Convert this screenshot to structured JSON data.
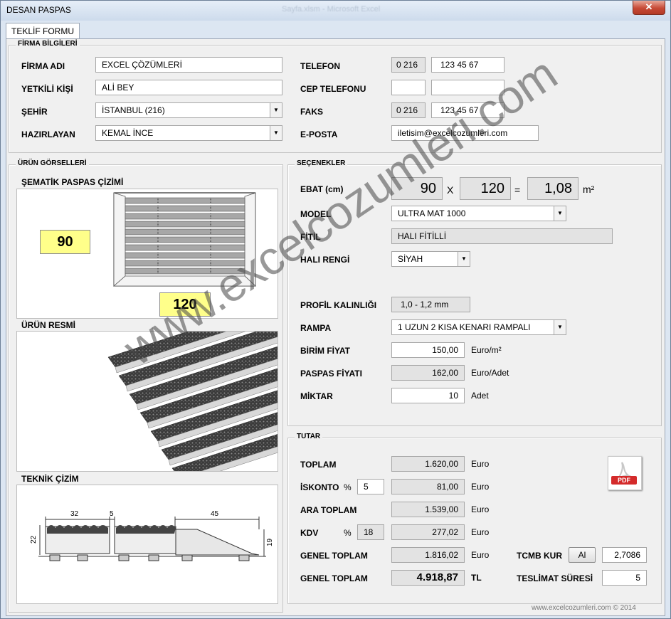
{
  "window": {
    "title": "DESAN PASPAS",
    "ghost_title": "Sayfa.xlsm - Microsoft Excel",
    "close_label": "✕"
  },
  "tab": {
    "label": "TEKLİF FORMU"
  },
  "firma": {
    "frame_label": "FİRMA BİLGİLERİ",
    "firma_adi_label": "FİRMA ADI",
    "firma_adi_value": "EXCEL ÇÖZÜMLERİ",
    "yetkili_label": "YETKİLİ KİŞİ",
    "yetkili_value": "ALİ BEY",
    "sehir_label": "ŞEHİR",
    "sehir_value": "İSTANBUL (216)",
    "hazirlayan_label": "HAZIRLAYAN",
    "hazirlayan_value": "KEMAL İNCE",
    "telefon_label": "TELEFON",
    "telefon_code": "0 216",
    "telefon_number": "123 45 67",
    "cep_label": "CEP TELEFONU",
    "cep_code": "",
    "cep_number": "",
    "faks_label": "FAKS",
    "faks_code": "0 216",
    "faks_number": "123 45 67",
    "eposta_label": "E-POSTA",
    "eposta_value": "iletisim@excelcozumleri.com"
  },
  "urun": {
    "frame_label": "ÜRÜN GÖRSELLERİ",
    "sematik_label": "ŞEMATİK PASPAS ÇİZİMİ",
    "width_value": "90",
    "length_value": "120",
    "resim_label": "ÜRÜN RESMİ",
    "teknik_label": "TEKNİK ÇİZİM",
    "dim_32": "32",
    "dim_5": "5",
    "dim_45": "45",
    "dim_22": "22",
    "dim_19": "19"
  },
  "secenekler": {
    "frame_label": "SEÇENEKLER",
    "ebat_label": "EBAT (cm)",
    "ebat_w": "90",
    "ebat_x": "X",
    "ebat_h": "120",
    "ebat_eq": "=",
    "ebat_area": "1,08",
    "ebat_unit": "m²",
    "model_label": "MODEL",
    "model_value": "ULTRA MAT 1000",
    "fitil_label": "FİTİL",
    "fitil_value": "HALI FİTİLLİ",
    "hali_label": "HALI RENGİ",
    "hali_value": "SİYAH",
    "profil_label": "PROFİL KALINLIĞI",
    "profil_value": "1,0 - 1,2 mm",
    "rampa_label": "RAMPA",
    "rampa_value": "1 UZUN 2 KISA KENARI RAMPALI",
    "birim_label": "BİRİM FİYAT",
    "birim_value": "150,00",
    "birim_unit": "Euro/m²",
    "paspas_label": "PASPAS FİYATI",
    "paspas_value": "162,00",
    "paspas_unit": "Euro/Adet",
    "miktar_label": "MİKTAR",
    "miktar_value": "10",
    "miktar_unit": "Adet"
  },
  "tutar": {
    "frame_label": "TUTAR",
    "toplam_label": "TOPLAM",
    "toplam_value": "1.620,00",
    "toplam_unit": "Euro",
    "iskonto_label": "İSKONTO",
    "iskonto_pct_sign": "%",
    "iskonto_pct": "5",
    "iskonto_value": "81,00",
    "iskonto_unit": "Euro",
    "ara_label": "ARA TOPLAM",
    "ara_value": "1.539,00",
    "ara_unit": "Euro",
    "kdv_label": "KDV",
    "kdv_pct_sign": "%",
    "kdv_pct": "18",
    "kdv_value": "277,02",
    "kdv_unit": "Euro",
    "genel_euro_label": "GENEL TOPLAM",
    "genel_euro_value": "1.816,02",
    "genel_euro_unit": "Euro",
    "genel_tl_label": "GENEL TOPLAM",
    "genel_tl_value": "4.918,87",
    "genel_tl_unit": "TL",
    "tcmb_label": "TCMB KUR",
    "tcmb_button": "Al",
    "tcmb_value": "2,7086",
    "teslimat_label": "TESLİMAT SÜRESİ",
    "teslimat_value": "5",
    "pdf_label": "PDF"
  },
  "watermark": "www.excelcozumleri.com",
  "footer": "www.excelcozumleri.com © 2014",
  "colors": {
    "highlight": "#ffff8a",
    "pdf_red": "#d42b2b",
    "window_border": "#6d7f97"
  }
}
